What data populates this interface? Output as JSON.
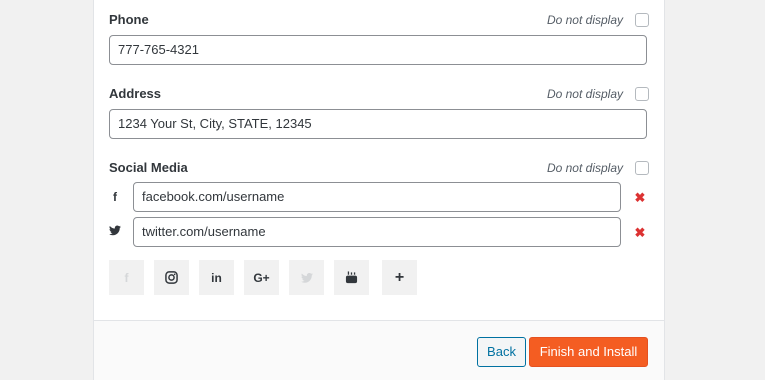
{
  "fields": {
    "phone": {
      "label": "Phone",
      "value": "777-765-4321",
      "do_not_display": "Do not display"
    },
    "address": {
      "label": "Address",
      "value": "1234 Your St, City, STATE, 12345",
      "do_not_display": "Do not display"
    },
    "social": {
      "label": "Social Media",
      "do_not_display": "Do not display",
      "items": [
        {
          "icon": "facebook-icon",
          "glyph": "f",
          "value": "facebook.com/username",
          "remove": "✖"
        },
        {
          "icon": "twitter-icon",
          "value": "twitter.com/username",
          "remove": "✖"
        }
      ]
    }
  },
  "add_buttons": [
    {
      "icon": "facebook-icon",
      "glyph": "f",
      "disabled": true
    },
    {
      "icon": "instagram-icon",
      "disabled": false
    },
    {
      "icon": "linkedin-icon",
      "glyph": "in",
      "disabled": false
    },
    {
      "icon": "google-plus-icon",
      "glyph": "G+",
      "disabled": false
    },
    {
      "icon": "twitter-icon",
      "disabled": true
    },
    {
      "icon": "youtube-icon",
      "disabled": false
    },
    {
      "icon": "plus-icon",
      "glyph": "+",
      "disabled": false
    }
  ],
  "footer": {
    "back_label": "Back",
    "finish_label": "Finish and Install"
  },
  "colors": {
    "accent": "#f45d22",
    "link": "#0071a1",
    "remove": "#dc3232"
  }
}
